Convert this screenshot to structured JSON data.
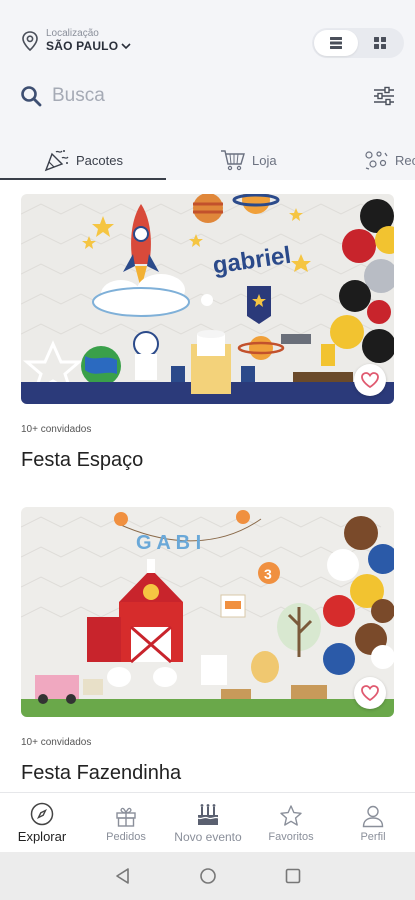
{
  "location": {
    "label": "Localização",
    "city": "SÃO PAULO"
  },
  "search": {
    "placeholder": "Busca"
  },
  "tabs": [
    {
      "label": "Pacotes",
      "icon": "party-popper-icon",
      "active": true
    },
    {
      "label": "Loja",
      "icon": "shopping-cart-icon",
      "active": false
    },
    {
      "label": "Rec",
      "icon": "confetti-icon",
      "active": false
    }
  ],
  "cards": [
    {
      "title": "Festa Espaço",
      "guests": "10+ convidados",
      "banner": "gabriel",
      "favorited": false
    },
    {
      "title": "Festa Fazendinha",
      "guests": "10+ convidados",
      "banner": "G A B I",
      "favorited": false
    }
  ],
  "bottom_nav": [
    {
      "label": "Explorar",
      "icon": "compass-icon",
      "active": true
    },
    {
      "label": "Pedidos",
      "icon": "gift-icon",
      "active": false
    },
    {
      "label": "Novo evento",
      "icon": "cake-icon",
      "active": false
    },
    {
      "label": "Favoritos",
      "icon": "star-icon",
      "active": false
    },
    {
      "label": "Perfil",
      "icon": "user-icon",
      "active": false
    }
  ],
  "colors": {
    "accent": "#3a3f4a",
    "header_bg": "#f4f5f8",
    "favorite": "#e05a70"
  }
}
